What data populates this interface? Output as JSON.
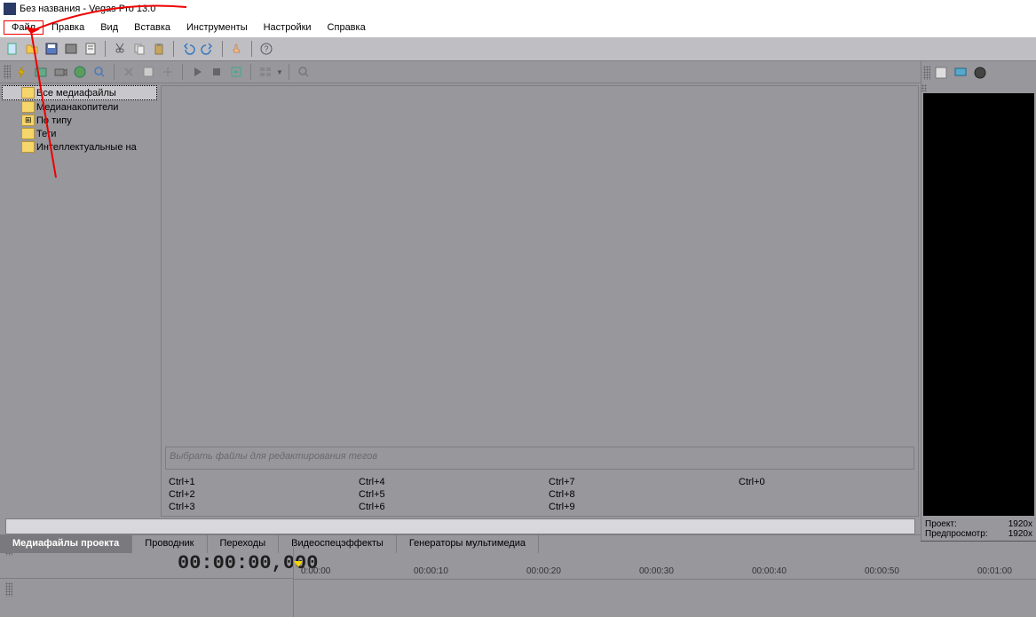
{
  "title": "Без названия - Vegas Pro 13.0",
  "menu": [
    "Файл",
    "Правка",
    "Вид",
    "Вставка",
    "Инструменты",
    "Настройки",
    "Справка"
  ],
  "tree": {
    "items": [
      {
        "label": "Все медиафайлы",
        "selected": true
      },
      {
        "label": "Медианакопители"
      },
      {
        "label": "По типу"
      },
      {
        "label": "Теги"
      },
      {
        "label": "Интеллектуальные на"
      }
    ]
  },
  "tagPlaceholder": "Выбрать файлы для редактирования тегов",
  "shortcuts": [
    [
      "Ctrl+1",
      "Ctrl+4",
      "Ctrl+7",
      "Ctrl+0"
    ],
    [
      "Ctrl+2",
      "Ctrl+5",
      "Ctrl+8",
      ""
    ],
    [
      "Ctrl+3",
      "Ctrl+6",
      "Ctrl+9",
      ""
    ]
  ],
  "tabs": [
    "Медиафайлы проекта",
    "Проводник",
    "Переходы",
    "Видеоспецэффекты",
    "Генераторы мультимедиа"
  ],
  "timecode": "00:00:00,000",
  "ruler": [
    "0:00:00",
    "00:00:10",
    "00:00:20",
    "00:00:30",
    "00:00:40",
    "00:00:50",
    "00:01:00"
  ],
  "preview": {
    "projectLabel": "Проект:",
    "projectVal": "1920x",
    "previewLabel": "Предпросмотр:",
    "previewVal": "1920x"
  }
}
